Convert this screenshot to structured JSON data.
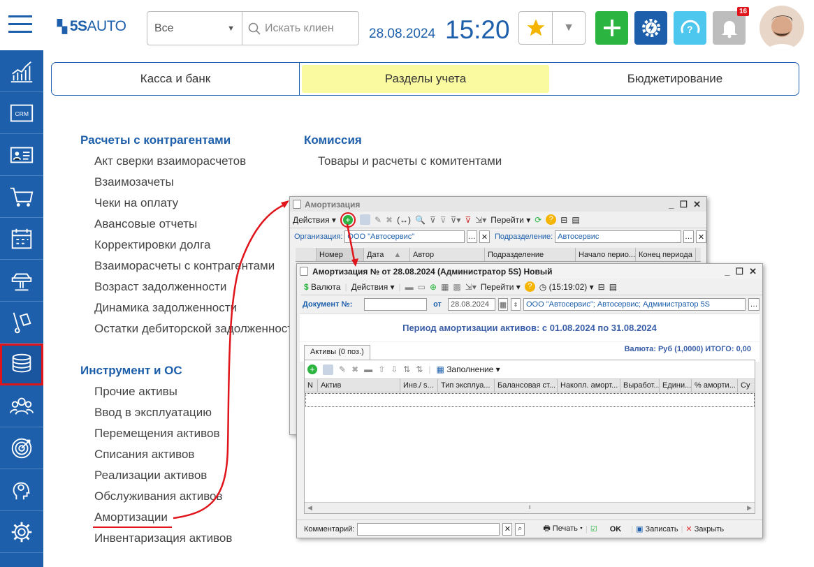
{
  "header": {
    "logo": "5SAUTO",
    "filter_value": "Все",
    "search_placeholder": "Искать клиен",
    "date": "28.08.2024",
    "time": "15:20",
    "notifications_count": "16"
  },
  "tabs": [
    {
      "label": "Касса и банк"
    },
    {
      "label": "Разделы учета"
    },
    {
      "label": "Бюджетирование"
    }
  ],
  "sections": {
    "counterparties": {
      "title": "Расчеты с контрагентами",
      "items": [
        "Акт сверки взаиморасчетов",
        "Взаимозачеты",
        "Чеки на оплату",
        "Авансовые отчеты",
        "Корректировки долга",
        "Взаиморасчеты с контрагентами",
        "Возраст задолженности",
        "Динамика задолженности",
        "Остатки дебиторской задолженности"
      ]
    },
    "commission": {
      "title": "Комиссия",
      "items": [
        "Товары и расчеты с комитентами"
      ]
    },
    "assets": {
      "title": "Инструмент и ОС",
      "items": [
        "Прочие активы",
        "Ввод в эксплуатацию",
        "Перемещения активов",
        "Списания активов",
        "Реализации активов",
        "Обслуживания активов",
        "Амортизации",
        "Инвентаризация активов"
      ]
    }
  },
  "list_window": {
    "title": "Амортизация",
    "actions_label": "Действия",
    "goto_label": "Перейти",
    "org_label": "Организация:",
    "org_value": "ООО \"Автосервис\"",
    "dept_label": "Подразделение:",
    "dept_value": "Автосервис",
    "columns": [
      "Номер",
      "Дата",
      "Автор",
      "Подразделение",
      "Начало перио...",
      "Конец периода"
    ]
  },
  "doc_window": {
    "title": "Амортизация №  от 28.08.2024 (Администратор 5S) Новый",
    "currency_btn": "Валюта",
    "actions_label": "Действия",
    "goto_label": "Перейти",
    "time_btn": "(15:19:02)",
    "doc_no_label": "Документ №:",
    "doc_no_value": "",
    "from_label": "от",
    "date_value": "28.08.2024",
    "org_value": "ООО \"Автосервис\"; Автосервис; Администратор 5S",
    "period_text": "Период амортизации активов: с 01.08.2024 по 31.08.2024",
    "currency_text": "Валюта: Руб (1,0000) ИТОГО: 0,00",
    "assets_tab": "Активы (0 поз.)",
    "fill_btn": "Заполнение",
    "columns": [
      "N",
      "Актив",
      "Инв./ s...",
      "Тип эксплуа...",
      "Балансовая ст...",
      "Накопл. аморт...",
      "Выработ...",
      "Едини...",
      "% аморти...",
      "Су"
    ],
    "comment_label": "Комментарий:",
    "comment_value": "",
    "print_btn": "Печать",
    "ok_btn": "OK",
    "save_btn": "Записать",
    "close_btn": "Закрыть"
  },
  "colors": {
    "brand": "#1d5fab",
    "active_tab": "#fafaa0",
    "highlight": "#e0141b",
    "green": "#2bb540"
  }
}
